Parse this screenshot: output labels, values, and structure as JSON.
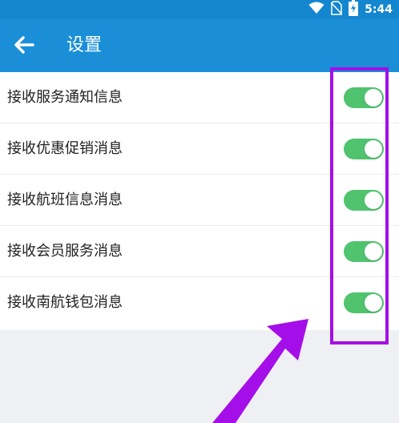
{
  "status_bar": {
    "time": "5:44",
    "icons": [
      "wifi-icon",
      "no-sim-icon",
      "battery-charging-icon"
    ]
  },
  "app_bar": {
    "back_icon": "arrow-left-icon",
    "title": "设置"
  },
  "settings": [
    {
      "label": "接收服务通知信息",
      "enabled": true
    },
    {
      "label": "接收优惠促销消息",
      "enabled": true
    },
    {
      "label": "接收航班信息消息",
      "enabled": true
    },
    {
      "label": "接收会员服务消息",
      "enabled": true
    },
    {
      "label": "接收南航钱包消息",
      "enabled": true
    }
  ],
  "colors": {
    "header": "#1a8fd8",
    "status_bar": "#1386cf",
    "toggle_on": "#4fc36e",
    "annotation": "#a40ee8",
    "background": "#eef0f3"
  }
}
